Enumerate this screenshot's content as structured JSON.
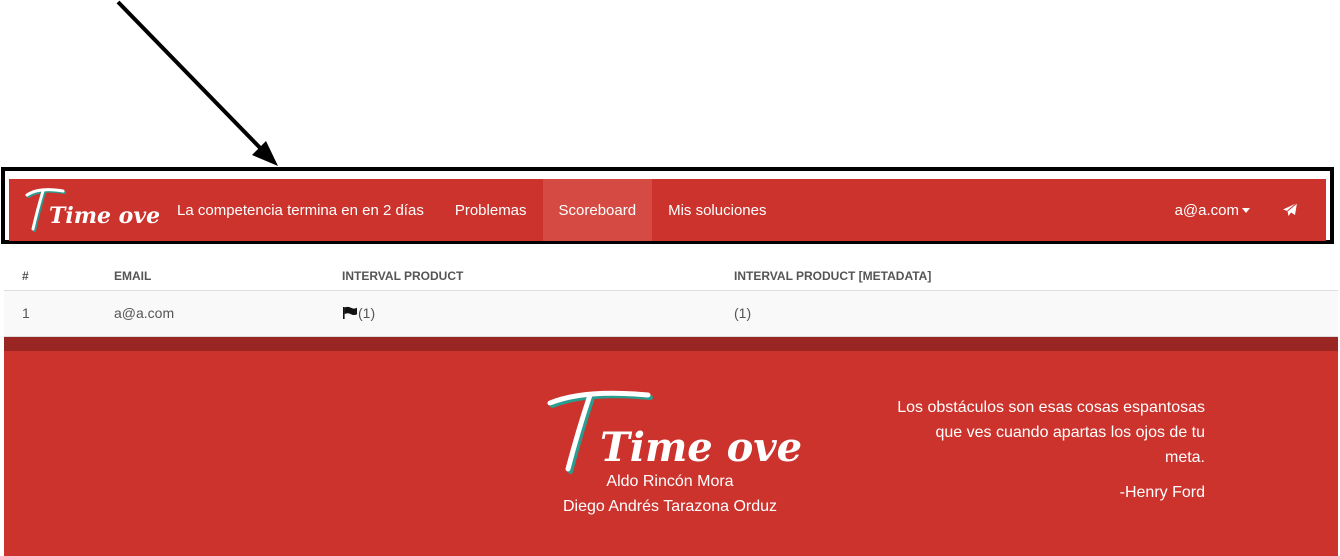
{
  "navbar": {
    "brand_text": "Time over",
    "countdown_label": "La competencia termina en en 2 días",
    "items": [
      {
        "label": "Problemas"
      },
      {
        "label": "Scoreboard"
      },
      {
        "label": "Mis soluciones"
      }
    ],
    "active_item": "Scoreboard",
    "user_email": "a@a.com",
    "send_icon": "paper-plane-icon"
  },
  "scoreboard": {
    "headers": [
      "#",
      "EMAIL",
      "INTERVAL PRODUCT",
      "INTERVAL PRODUCT [METADATA]"
    ],
    "rows": [
      {
        "rank": "1",
        "email": "a@a.com",
        "flag_icon": "flag-icon",
        "interval_product": "(1)",
        "metadata": "(1)"
      }
    ]
  },
  "footer": {
    "logo_text": "Time over",
    "authors": [
      "Aldo Rincón Mora",
      "Diego Andrés Tarazona Orduz"
    ],
    "quote_lines": [
      "Los obstáculos son esas cosas espantosas",
      "que ves cuando apartas los ojos de tu",
      "meta."
    ],
    "quote_author": "-Henry Ford"
  },
  "colors": {
    "primary": "#cc332d",
    "primary_dark": "#992622",
    "active_nav": "#d54b44",
    "logo_accent": "#2a9d8f"
  }
}
